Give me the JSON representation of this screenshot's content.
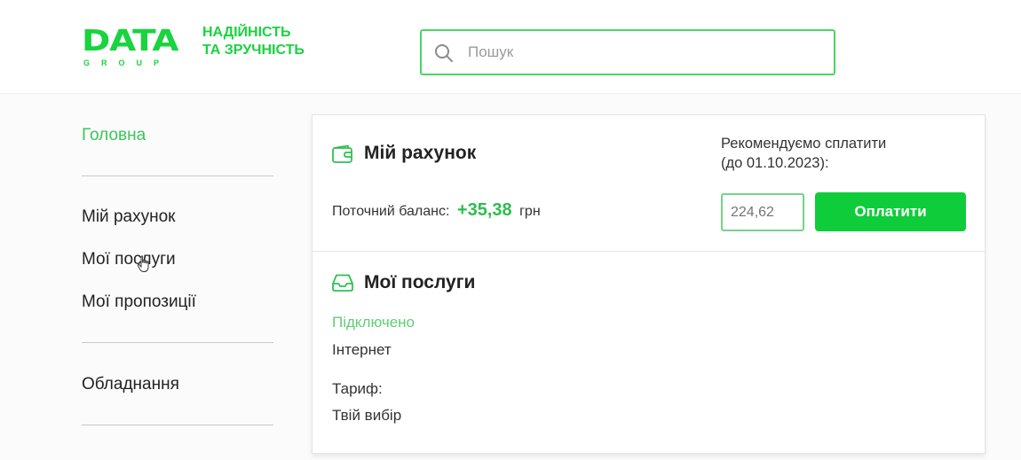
{
  "header": {
    "logo": {
      "main": "DATA",
      "sub": "GROUP"
    },
    "tagline": [
      "НАДІЙНІСТЬ",
      "ТА ЗРУЧНІСТЬ"
    ],
    "search": {
      "placeholder": "Пошук",
      "value": ""
    }
  },
  "sidebar": {
    "items": [
      {
        "label": "Головна",
        "active": true
      },
      {
        "label": "Мій рахунок"
      },
      {
        "label": "Мої послуги"
      },
      {
        "label": "Мої пропозиції"
      },
      {
        "label": "Обладнання"
      }
    ]
  },
  "account": {
    "title": "Мій рахунок",
    "balance_label": "Поточний баланс:",
    "balance_value": "+35,38",
    "currency": "грн",
    "recommend_line1": "Рекомендуємо сплатити",
    "recommend_line2": "(до 01.10.2023):",
    "amount_placeholder": "224,62",
    "pay_button": "Оплатити"
  },
  "services": {
    "title": "Мої послуги",
    "status": "Підключено",
    "service": "Інтернет",
    "tariff_label": "Тариф:",
    "tariff_value": "Твій вибір"
  },
  "colors": {
    "brand_green": "#19d33f",
    "button_green": "#0fcc3b",
    "balance_green": "#2cbd4e"
  }
}
